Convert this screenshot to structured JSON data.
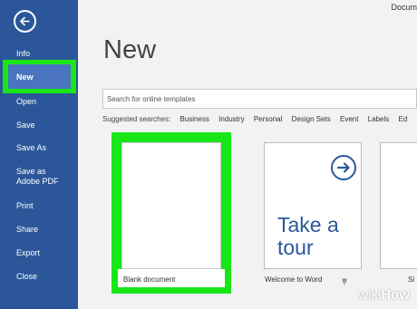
{
  "window": {
    "title_fragment": "Docum"
  },
  "sidebar": {
    "items": [
      {
        "label": "Info"
      },
      {
        "label": "New"
      },
      {
        "label": "Open"
      },
      {
        "label": "Save"
      },
      {
        "label": "Save As"
      },
      {
        "label": "Save as Adobe PDF"
      },
      {
        "label": "Print"
      },
      {
        "label": "Share"
      },
      {
        "label": "Export"
      },
      {
        "label": "Close"
      }
    ],
    "selected": "New",
    "bg_color": "#2b579a",
    "highlight_color": "#19e619"
  },
  "main": {
    "title": "New",
    "search": {
      "placeholder": "Search for online templates"
    },
    "suggested": {
      "label": "Suggested searches:",
      "items": [
        "Business",
        "Industry",
        "Personal",
        "Design Sets",
        "Event",
        "Labels",
        "Ed"
      ]
    },
    "templates": [
      {
        "label": "Blank document"
      },
      {
        "label": "Welcome to Word",
        "tile_text": "Take a tour"
      },
      {
        "label": "Si"
      }
    ]
  },
  "watermark": {
    "wiki": "wiki",
    "how": "How"
  },
  "icons": {
    "back": "back-arrow-icon",
    "tour": "forward-arrow-icon",
    "pin": "pin-icon"
  }
}
